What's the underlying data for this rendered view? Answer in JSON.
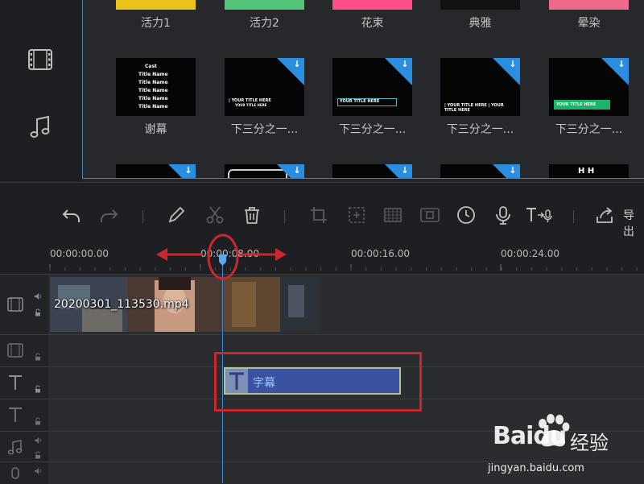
{
  "library": {
    "row1": [
      {
        "label": "活力1",
        "color": "#e9c21a"
      },
      {
        "label": "活力2",
        "color": "#53c47a"
      },
      {
        "label": "花束",
        "color": "#ff4f86"
      },
      {
        "label": "典雅",
        "color": "#111111"
      },
      {
        "label": "晕染",
        "color": "#f06a8a"
      }
    ],
    "row2": [
      {
        "label": "谢幕",
        "caption": [
          "Cast",
          "Title Name",
          "Title Name",
          "Title Name",
          "Title Name",
          "Title Name"
        ]
      },
      {
        "label": "下三分之一...",
        "caption": [
          "| YOUR TITLE HERE",
          "YOUR TITLE HERE"
        ]
      },
      {
        "label": "下三分之一...",
        "caption": [
          "YOUR TITLE HERE"
        ]
      },
      {
        "label": "下三分之一...",
        "caption": [
          "| YOUR TITLE HERE | YOUR TITLE HERE"
        ]
      },
      {
        "label": "下三分之一...",
        "caption": [
          "YOUR TITLE HERE"
        ]
      }
    ],
    "row3_caption": "H H"
  },
  "sidebar": {
    "items": [
      {
        "icon": "film-icon"
      },
      {
        "icon": "music-note-icon"
      }
    ]
  },
  "toolbar": {
    "export_label": "导出",
    "tools": [
      "undo-icon",
      "redo-icon",
      "pencil-icon",
      "scissors-icon",
      "trash-icon",
      "crop-icon",
      "zoom-frame-icon",
      "mosaic-icon",
      "freeze-frame-icon",
      "clock-icon",
      "microphone-icon",
      "text-to-speech-icon",
      "export-icon"
    ]
  },
  "ruler": {
    "ticks": [
      "00:00:00.00",
      "00:00:08.00",
      "00:00:16.00",
      "00:00:24.00"
    ]
  },
  "timeline": {
    "video_clip": {
      "name": "20200301_113530.mp4"
    },
    "subtitle_clip": {
      "label": "字幕"
    }
  },
  "watermark": {
    "brand": "Baidu",
    "name": "经验",
    "url": "jingyan.baidu.com"
  },
  "colors": {
    "accent": "#3d8ed6",
    "highlight": "#c8282c",
    "subtitle_clip": "#3a52a0"
  }
}
